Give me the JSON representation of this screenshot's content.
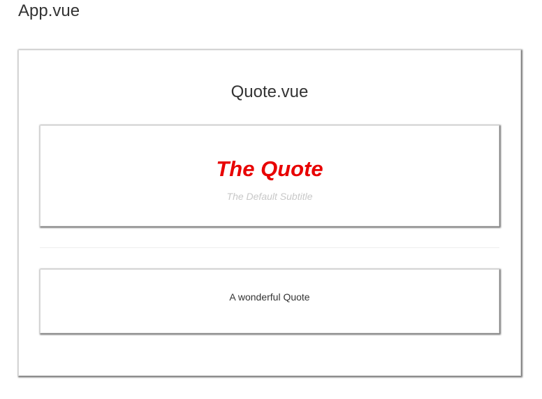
{
  "app": {
    "title": "App.vue"
  },
  "quote_component": {
    "title": "Quote.vue",
    "quote_text": "The Quote",
    "subtitle": "The Default Subtitle",
    "body_text": "A wonderful Quote"
  },
  "colors": {
    "quote_accent": "#e80000",
    "subtitle_gray": "#c8c8c8",
    "text": "#333333"
  }
}
